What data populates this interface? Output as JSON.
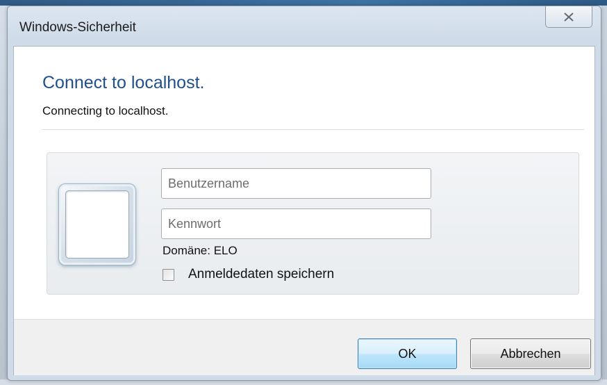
{
  "window": {
    "title": "Windows-Sicherheit",
    "close_icon": "close-x-icon"
  },
  "header": {
    "title": "Connect to localhost.",
    "subtitle": "Connecting to localhost."
  },
  "credentials": {
    "avatar_icon": "user-tile-icon",
    "username": {
      "value": "",
      "placeholder": "Benutzername"
    },
    "password": {
      "value": "",
      "placeholder": "Kennwort"
    },
    "domain_text": "Domäne: ELO",
    "remember": {
      "label": "Anmeldedaten speichern",
      "checked": false
    }
  },
  "buttons": {
    "ok_label": "OK",
    "cancel_label": "Abbrechen"
  },
  "colors": {
    "title_blue": "#1f4f8c",
    "ok_button_border": "#3c7fb1"
  }
}
